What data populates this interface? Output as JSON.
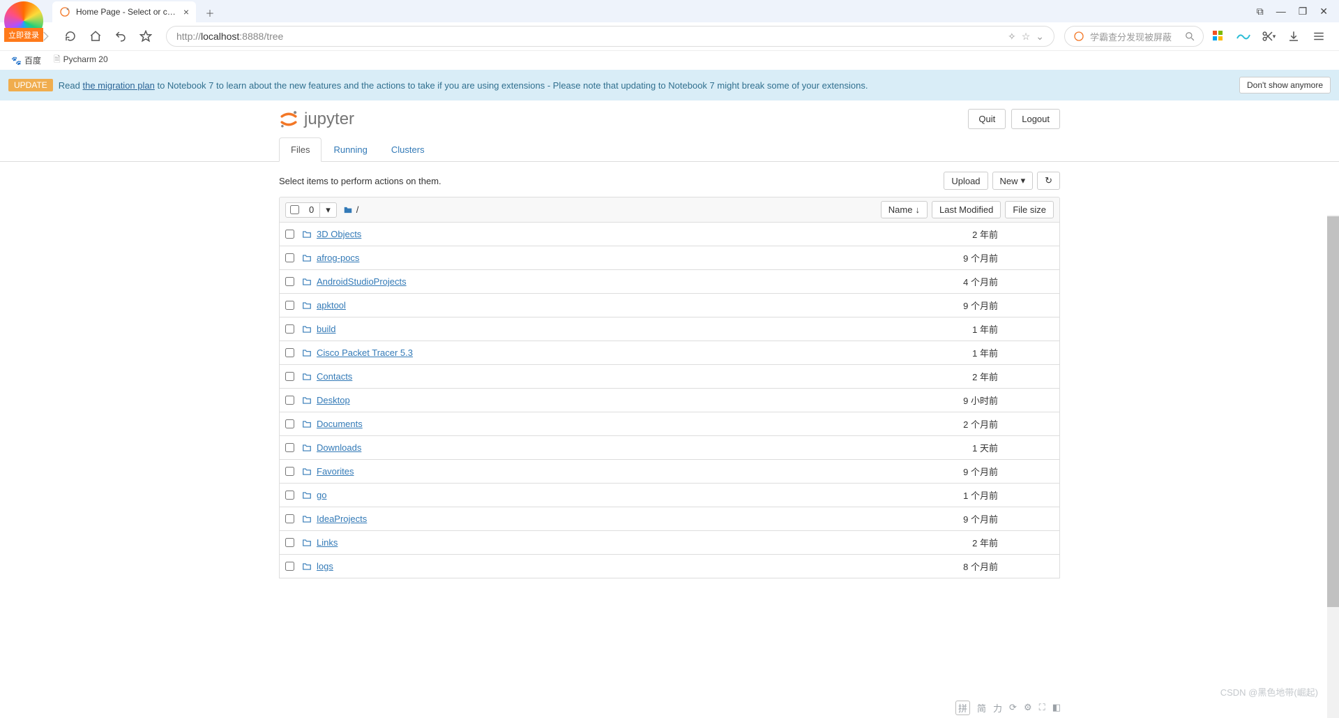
{
  "window": {
    "close_symbol": "✕",
    "max_symbol": "❐",
    "min_symbol": "—",
    "set_symbol": "⧉"
  },
  "browser": {
    "tab_title": "Home Page - Select or create",
    "tab_close": "×",
    "url_prefix": "http://",
    "url_host": "localhost",
    "url_path": ":8888/tree",
    "search_placeholder": "学霸查分发现被屏蔽",
    "bookmarks": [
      "百度",
      "Pycharm 20"
    ],
    "login_label": "立即登录"
  },
  "banner": {
    "tag": "UPDATE",
    "before_link": "Read ",
    "link_text": "the migration plan",
    "after_link": " to Notebook 7 to learn about the new features and the actions to take if you are using extensions - Please note that updating to Notebook 7 might break some of your extensions.",
    "dont_show": "Don't show anymore"
  },
  "header": {
    "logo_text": "jupyter",
    "quit": "Quit",
    "logout": "Logout"
  },
  "tabs": {
    "files": "Files",
    "running": "Running",
    "clusters": "Clusters"
  },
  "files": {
    "hint": "Select items to perform actions on them.",
    "upload": "Upload",
    "new": "New",
    "refresh": "↻",
    "sel_count": "0",
    "caret": "▾",
    "crumb": "/",
    "name_header": "Name",
    "mod_header": "Last Modified",
    "size_header": "File size",
    "rows": [
      {
        "name": "3D Objects",
        "modified": "2 年前"
      },
      {
        "name": "afrog-pocs",
        "modified": "9 个月前"
      },
      {
        "name": "AndroidStudioProjects",
        "modified": "4 个月前"
      },
      {
        "name": "apktool",
        "modified": "9 个月前"
      },
      {
        "name": "build",
        "modified": "1 年前"
      },
      {
        "name": "Cisco Packet Tracer 5.3",
        "modified": "1 年前"
      },
      {
        "name": "Contacts",
        "modified": "2 年前"
      },
      {
        "name": "Desktop",
        "modified": "9 小时前"
      },
      {
        "name": "Documents",
        "modified": "2 个月前"
      },
      {
        "name": "Downloads",
        "modified": "1 天前"
      },
      {
        "name": "Favorites",
        "modified": "9 个月前"
      },
      {
        "name": "go",
        "modified": "1 个月前"
      },
      {
        "name": "IdeaProjects",
        "modified": "9 个月前"
      },
      {
        "name": "Links",
        "modified": "2 年前"
      },
      {
        "name": "logs",
        "modified": "8 个月前"
      }
    ]
  },
  "ime": {
    "label": "拼",
    "items": [
      "简",
      "力",
      "⟳",
      "⚙",
      "⛶",
      "◧"
    ]
  },
  "watermark": "CSDN @黑色地带(崛起)"
}
